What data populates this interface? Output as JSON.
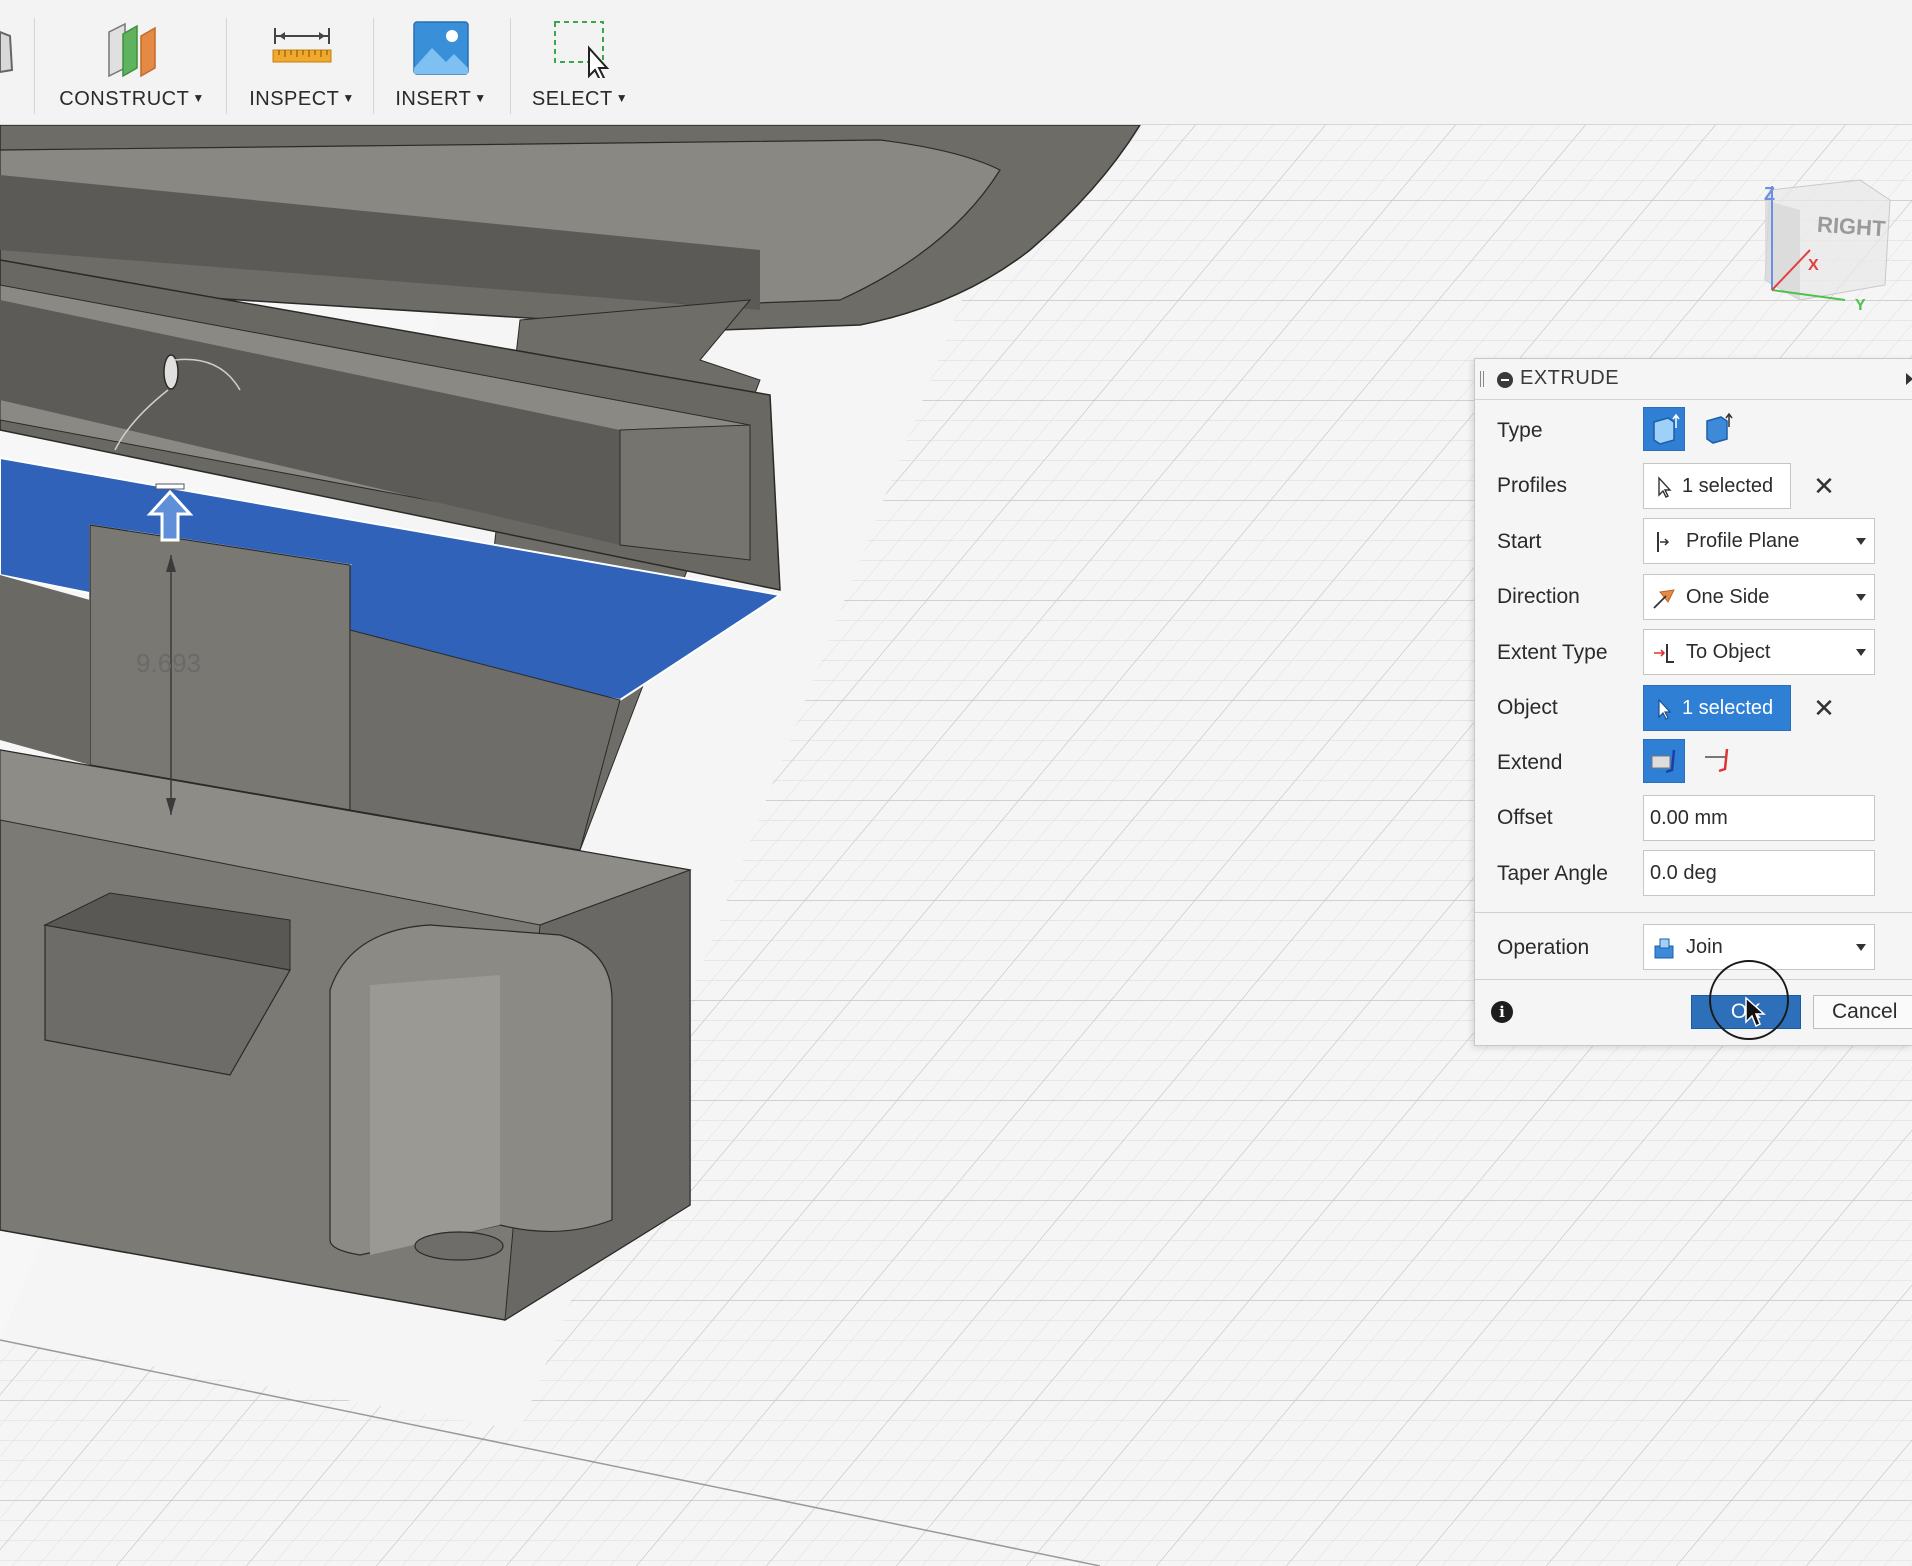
{
  "toolbar": {
    "groups": [
      {
        "label": "CONSTRUCT",
        "icon": "construct-planes-icon"
      },
      {
        "label": "INSPECT",
        "icon": "measure-ruler-icon"
      },
      {
        "label": "INSERT",
        "icon": "insert-image-icon"
      },
      {
        "label": "SELECT",
        "icon": "select-window-icon"
      }
    ]
  },
  "viewport": {
    "dimension_value": "9.693",
    "viewcube_face": "RIGHT",
    "axis_labels": {
      "z": "Z",
      "x": "X",
      "y": "Y"
    }
  },
  "dialog": {
    "title": "EXTRUDE",
    "rows": {
      "type": {
        "label": "Type"
      },
      "profiles": {
        "label": "Profiles",
        "value": "1 selected"
      },
      "start": {
        "label": "Start",
        "value": "Profile Plane"
      },
      "direction": {
        "label": "Direction",
        "value": "One Side"
      },
      "extent_type": {
        "label": "Extent Type",
        "value": "To Object"
      },
      "object": {
        "label": "Object",
        "value": "1 selected"
      },
      "extend": {
        "label": "Extend"
      },
      "offset": {
        "label": "Offset",
        "value": "0.00 mm"
      },
      "taper_angle": {
        "label": "Taper Angle",
        "value": "0.0 deg"
      },
      "operation": {
        "label": "Operation",
        "value": "Join"
      }
    },
    "buttons": {
      "ok": "OK",
      "cancel": "Cancel"
    },
    "colors": {
      "accent": "#2f7fd5",
      "ok": "#2d6fb8"
    }
  }
}
